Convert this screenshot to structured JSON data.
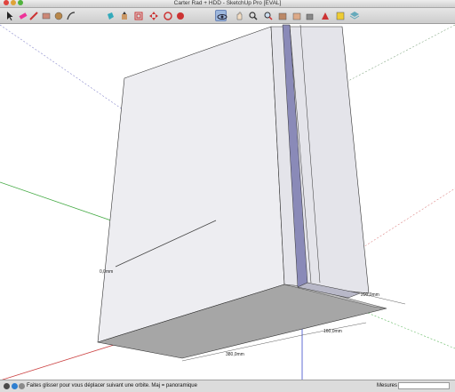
{
  "window": {
    "title": "Carter Rad + HDD - SketchUp Pro [EVAL]"
  },
  "toolbar": {
    "tools": [
      {
        "name": "select-tool-icon",
        "active": false
      },
      {
        "name": "eraser-tool-icon",
        "active": false
      },
      {
        "name": "pencil-tool-icon",
        "active": false
      },
      {
        "name": "rectangle-tool-icon",
        "active": false
      },
      {
        "name": "circle-tool-icon",
        "active": false
      },
      {
        "name": "arc-tool-icon",
        "active": false
      },
      {
        "name": "paint-bucket-tool-icon",
        "active": false
      },
      {
        "name": "push-pull-tool-icon",
        "active": false
      },
      {
        "name": "offset-tool-icon",
        "active": false
      },
      {
        "name": "move-tool-icon",
        "active": false
      },
      {
        "name": "rotate-tool-icon",
        "active": false
      },
      {
        "name": "follow-me-tool-icon",
        "active": false
      },
      {
        "name": "orbit-tool-icon",
        "active": true
      },
      {
        "name": "pan-tool-icon",
        "active": false
      },
      {
        "name": "zoom-tool-icon",
        "active": false
      },
      {
        "name": "zoom-extents-tool-icon",
        "active": false
      },
      {
        "name": "get-models-tool-icon",
        "active": false
      },
      {
        "name": "share-model-tool-icon",
        "active": false
      },
      {
        "name": "share-component-tool-icon",
        "active": false
      },
      {
        "name": "extension-warehouse-tool-icon",
        "active": false
      },
      {
        "name": "get-photo-texture-tool-icon",
        "active": false
      },
      {
        "name": "layout-tool-icon",
        "active": false
      }
    ]
  },
  "model": {
    "dimensions": {
      "width": "380,0mm",
      "depth": "160,0mm",
      "side": "200,0mm",
      "green_axis": "0,0mm"
    }
  },
  "statusbar": {
    "help_text": "Faites glisser pour vous déplacer suivant une orbite.  Maj = panoramique",
    "measure_label": "Mesures",
    "measure_value": ""
  },
  "colors": {
    "box_face_light": "#eeeef2",
    "box_face_right": "#e4e4ea",
    "box_bottom": "#a6a6a6",
    "slot": "#8a8ab8",
    "axis_green": "#44aa44",
    "axis_red": "#cc4444",
    "axis_blue": "#3a4acc"
  }
}
